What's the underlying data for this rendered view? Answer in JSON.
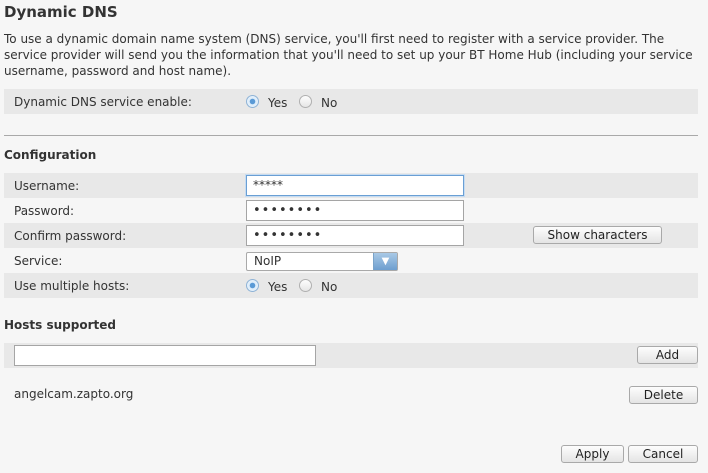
{
  "page": {
    "title": "Dynamic DNS",
    "intro": "To use a dynamic domain name system (DNS) service, you'll first need to register with a service provider. The service provider will send you the information that you'll need to set up your BT Home Hub (including your service username, password and host name)."
  },
  "enable": {
    "label": "Dynamic DNS service enable:",
    "yes": "Yes",
    "no": "No",
    "selected": "Yes"
  },
  "configuration": {
    "heading": "Configuration",
    "username_label": "Username:",
    "username_value": "*****",
    "password_label": "Password:",
    "password_value": "••••••••",
    "confirm_label": "Confirm password:",
    "confirm_value": "••••••••",
    "show_characters": "Show characters",
    "service_label": "Service:",
    "service_value": "NoIP",
    "multiple_hosts_label": "Use multiple hosts:",
    "multiple_yes": "Yes",
    "multiple_no": "No",
    "multiple_selected": "Yes"
  },
  "hosts": {
    "heading": "Hosts supported",
    "new_host_value": "",
    "add_label": "Add",
    "items": [
      {
        "name": "angelcam.zapto.org",
        "delete_label": "Delete"
      }
    ]
  },
  "footer": {
    "apply_label": "Apply",
    "cancel_label": "Cancel"
  },
  "colors": {
    "accent": "#5a9ad6",
    "band": "#e8e8e8",
    "background": "#f6f6f6"
  }
}
